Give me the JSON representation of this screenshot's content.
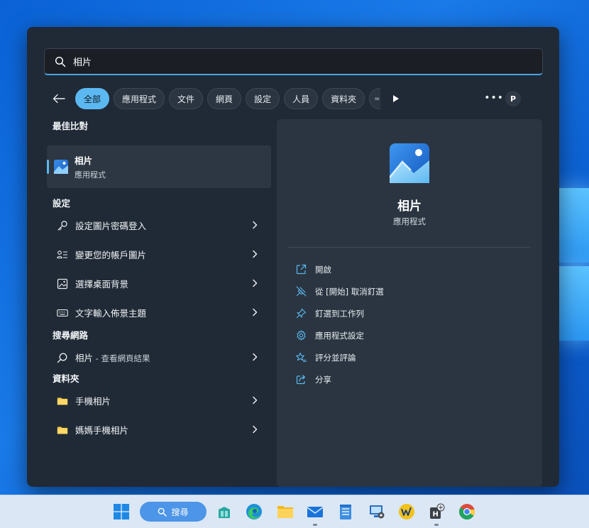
{
  "search": {
    "value": "相片",
    "placeholder": ""
  },
  "filters": {
    "chips": [
      "全部",
      "應用程式",
      "文件",
      "網頁",
      "設定",
      "人員",
      "資料夾"
    ],
    "active_index": 0,
    "more_label": "•••",
    "avatar_letter": "P"
  },
  "best_match": {
    "section": "最佳比對",
    "name": "相片",
    "type": "應用程式"
  },
  "settings_section": {
    "title": "設定",
    "items": [
      {
        "label": "設定圖片密碼登入",
        "icon": "key-icon"
      },
      {
        "label": "變更您的帳戶圖片",
        "icon": "account-picture-icon"
      },
      {
        "label": "選擇桌面背景",
        "icon": "image-icon"
      },
      {
        "label": "文字輸入佈景主題",
        "icon": "keyboard-icon"
      }
    ]
  },
  "web_section": {
    "title": "搜尋網路",
    "item": {
      "query": "相片",
      "suffix": " - 查看網頁結果",
      "icon": "search-icon"
    }
  },
  "folders_section": {
    "title": "資料夾",
    "items": [
      {
        "label": "手機相片",
        "icon": "folder-icon"
      },
      {
        "label": "媽媽手機相片",
        "icon": "folder-icon"
      }
    ]
  },
  "detail": {
    "title": "相片",
    "subtitle": "應用程式",
    "actions": [
      {
        "label": "開啟",
        "icon": "open-icon"
      },
      {
        "label": "從 [開始] 取消釘選",
        "icon": "unpin-icon"
      },
      {
        "label": "釘選到工作列",
        "icon": "pin-icon"
      },
      {
        "label": "應用程式設定",
        "icon": "gear-icon"
      },
      {
        "label": "評分並評論",
        "icon": "rate-icon"
      },
      {
        "label": "分享",
        "icon": "share-icon"
      }
    ]
  },
  "taskbar": {
    "search_label": "搜尋",
    "apps": [
      "start",
      "search",
      "windows-store",
      "edge",
      "file-explorer",
      "mail",
      "notepad",
      "remote-desktop",
      "word-web",
      "app-h",
      "chrome"
    ]
  },
  "colors": {
    "accent": "#5cb8f0",
    "panel": "#202a36",
    "detail_panel": "#2a3541"
  }
}
